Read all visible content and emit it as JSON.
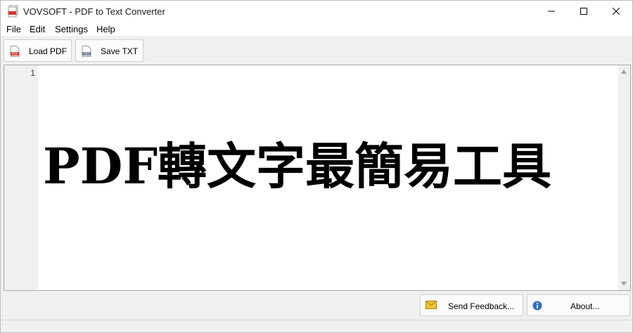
{
  "window": {
    "title": "VOVSOFT - PDF to Text Converter",
    "app_icon": "pdf-stack-icon"
  },
  "menu": {
    "items": [
      {
        "label": "File"
      },
      {
        "label": "Edit"
      },
      {
        "label": "Settings"
      },
      {
        "label": "Help"
      }
    ]
  },
  "toolbar": {
    "load_label": "Load PDF",
    "load_icon": "pdf-file-icon",
    "load_icon_text": "PDF",
    "save_label": "Save TXT",
    "save_icon": "txt-file-icon",
    "save_icon_text": "TXT"
  },
  "editor": {
    "line_number": "1",
    "text": "PDF轉文字最簡易工具"
  },
  "footer": {
    "feedback_label": "Send Feedback...",
    "feedback_icon": "envelope-icon",
    "about_label": "About...",
    "about_icon": "info-icon"
  },
  "colors": {
    "pdf_red": "#d9342b",
    "txt_gray": "#6e7f91",
    "envelope": "#f2c230",
    "info_blue": "#2f6fc7"
  }
}
